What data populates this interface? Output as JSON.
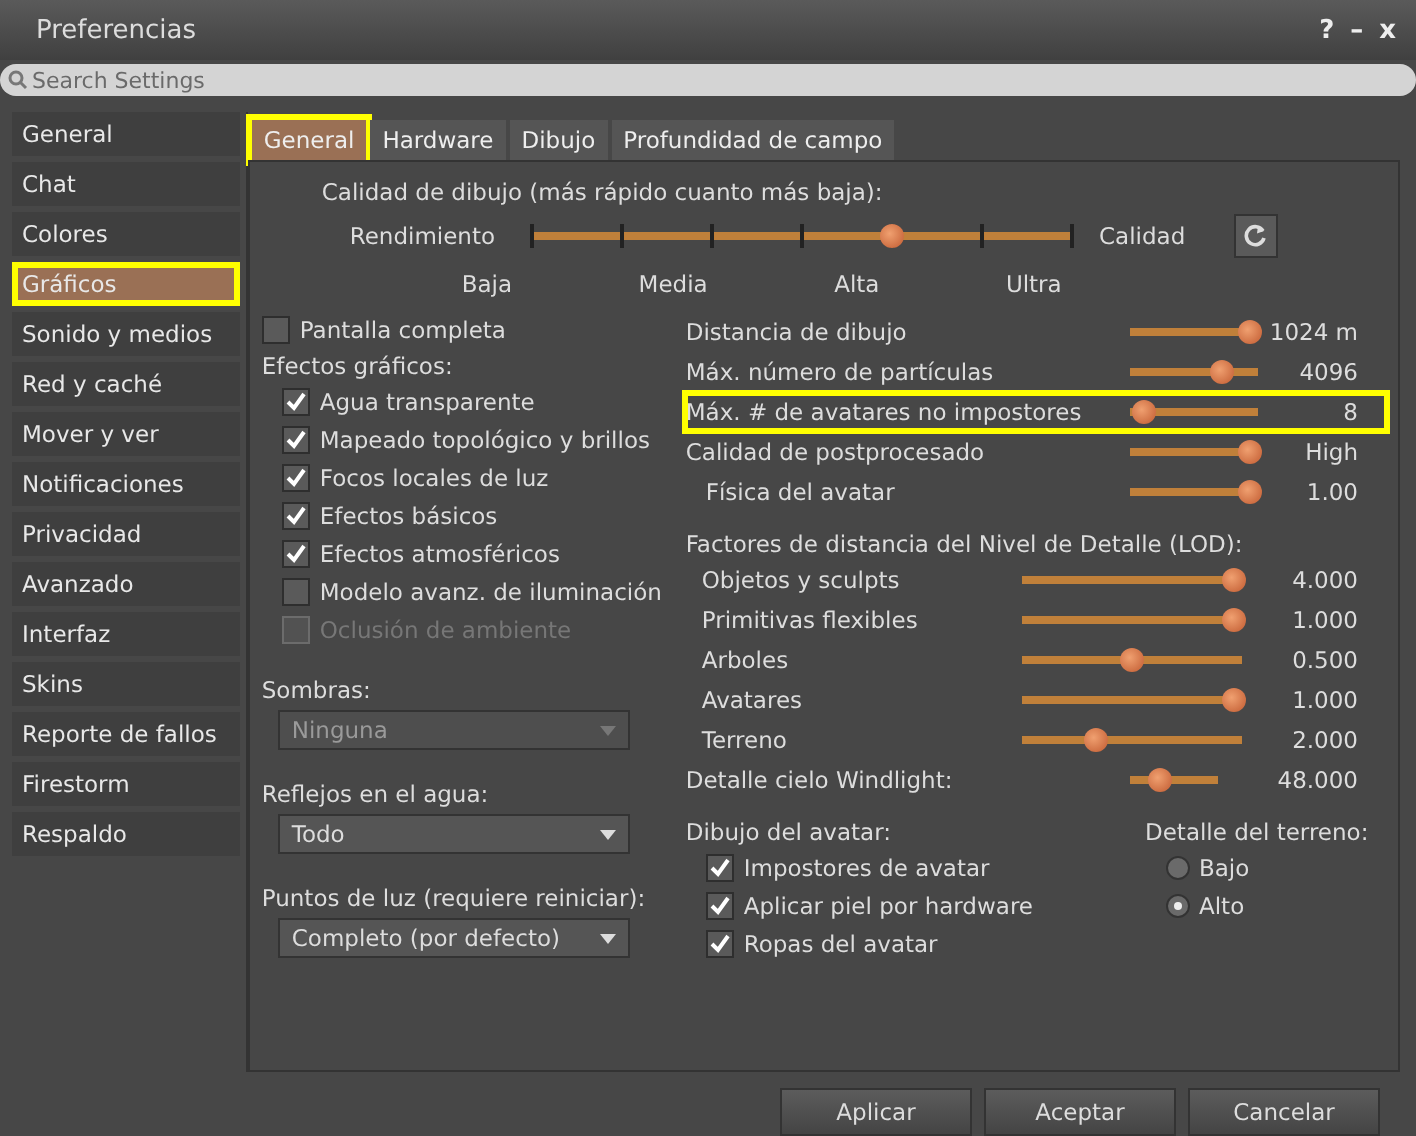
{
  "window": {
    "title": "Preferencias",
    "controls": [
      "?",
      "–",
      "x"
    ]
  },
  "search": {
    "placeholder": "Search Settings"
  },
  "sidebar": {
    "items": [
      {
        "label": "General",
        "selected": false,
        "highlighted": false
      },
      {
        "label": "Chat",
        "selected": false,
        "highlighted": false
      },
      {
        "label": "Colores",
        "selected": false,
        "highlighted": false
      },
      {
        "label": "Gráficos",
        "selected": true,
        "highlighted": true
      },
      {
        "label": "Sonido y medios",
        "selected": false,
        "highlighted": false
      },
      {
        "label": "Red y caché",
        "selected": false,
        "highlighted": false
      },
      {
        "label": "Mover y ver",
        "selected": false,
        "highlighted": false
      },
      {
        "label": "Notificaciones",
        "selected": false,
        "highlighted": false
      },
      {
        "label": "Privacidad",
        "selected": false,
        "highlighted": false
      },
      {
        "label": "Avanzado",
        "selected": false,
        "highlighted": false
      },
      {
        "label": "Interfaz",
        "selected": false,
        "highlighted": false
      },
      {
        "label": "Skins",
        "selected": false,
        "highlighted": false
      },
      {
        "label": "Reporte de fallos",
        "selected": false,
        "highlighted": false
      },
      {
        "label": "Firestorm",
        "selected": false,
        "highlighted": false
      },
      {
        "label": "Respaldo",
        "selected": false,
        "highlighted": false
      }
    ]
  },
  "tabs": [
    {
      "label": "General",
      "selected": true,
      "highlighted": true
    },
    {
      "label": "Hardware",
      "selected": false,
      "highlighted": false
    },
    {
      "label": "Dibujo",
      "selected": false,
      "highlighted": false
    },
    {
      "label": "Profundidad de campo",
      "selected": false,
      "highlighted": false
    }
  ],
  "quality": {
    "title": "Calidad de dibujo (más rápido cuanto más baja):",
    "left": "Rendimiento",
    "right": "Calidad",
    "level": 0.667,
    "ticks": [
      "Baja",
      "Media",
      "Alta",
      "Ultra"
    ]
  },
  "fullscreen": {
    "label": "Pantalla completa",
    "checked": false
  },
  "effects": {
    "title": "Efectos gráficos:",
    "items": [
      {
        "label": "Agua transparente",
        "checked": true,
        "disabled": false
      },
      {
        "label": "Mapeado topológico y brillos",
        "checked": true,
        "disabled": false
      },
      {
        "label": "Focos locales de luz",
        "checked": true,
        "disabled": false
      },
      {
        "label": "Efectos básicos",
        "checked": true,
        "disabled": false
      },
      {
        "label": "Efectos atmosféricos",
        "checked": true,
        "disabled": false
      },
      {
        "label": "Modelo avanz. de iluminación",
        "checked": false,
        "disabled": false
      },
      {
        "label": "Oclusión de ambiente",
        "checked": false,
        "disabled": true
      }
    ]
  },
  "dropdowns": [
    {
      "label": "Sombras:",
      "value": "Ninguna",
      "disabled": true
    },
    {
      "label": "Reflejos en el agua:",
      "value": "Todo",
      "disabled": false
    },
    {
      "label": "Puntos de luz (requiere reiniciar):",
      "value": "Completo (por defecto)",
      "disabled": false
    }
  ],
  "sliders": [
    {
      "label": "Distancia de dibujo",
      "level": 1,
      "reading": "1024 m",
      "highlighted": false
    },
    {
      "label": "Máx. número de partículas",
      "level": 0.75,
      "reading": "4096",
      "highlighted": false
    },
    {
      "label": "Máx. # de avatares no impostores",
      "level": 0.05,
      "reading": "8",
      "highlighted": true
    },
    {
      "label": "Calidad de postprocesado",
      "level": 1,
      "reading": "High",
      "highlighted": false
    },
    {
      "label": "Física del avatar",
      "level": 1,
      "reading": "1.00",
      "highlighted": false
    }
  ],
  "lod": {
    "title": "Factores de distancia del Nivel de Detalle (LOD):",
    "items": [
      {
        "label": "Objetos y sculpts",
        "level": 1,
        "reading": "4.000"
      },
      {
        "label": "Primitivas flexibles",
        "level": 1,
        "reading": "1.000"
      },
      {
        "label": "Arboles",
        "level": 0.5,
        "reading": "0.500"
      },
      {
        "label": "Avatares",
        "level": 1,
        "reading": "1.000"
      },
      {
        "label": "Terreno",
        "level": 0.32,
        "reading": "2.000"
      }
    ]
  },
  "windlight": {
    "label": "Detalle cielo Windlight:",
    "level": 0.3,
    "reading": "48.000"
  },
  "avatar": {
    "title": "Dibujo del avatar:",
    "items": [
      {
        "label": "Impostores de avatar",
        "checked": true
      },
      {
        "label": "Aplicar piel por hardware",
        "checked": true
      },
      {
        "label": "Ropas del avatar",
        "checked": true
      }
    ]
  },
  "terrain": {
    "title": "Detalle del terreno:",
    "options": [
      {
        "label": "Bajo",
        "selected": false
      },
      {
        "label": "Alto",
        "selected": true
      }
    ]
  },
  "buttons": [
    "Aplicar",
    "Aceptar",
    "Cancelar"
  ]
}
